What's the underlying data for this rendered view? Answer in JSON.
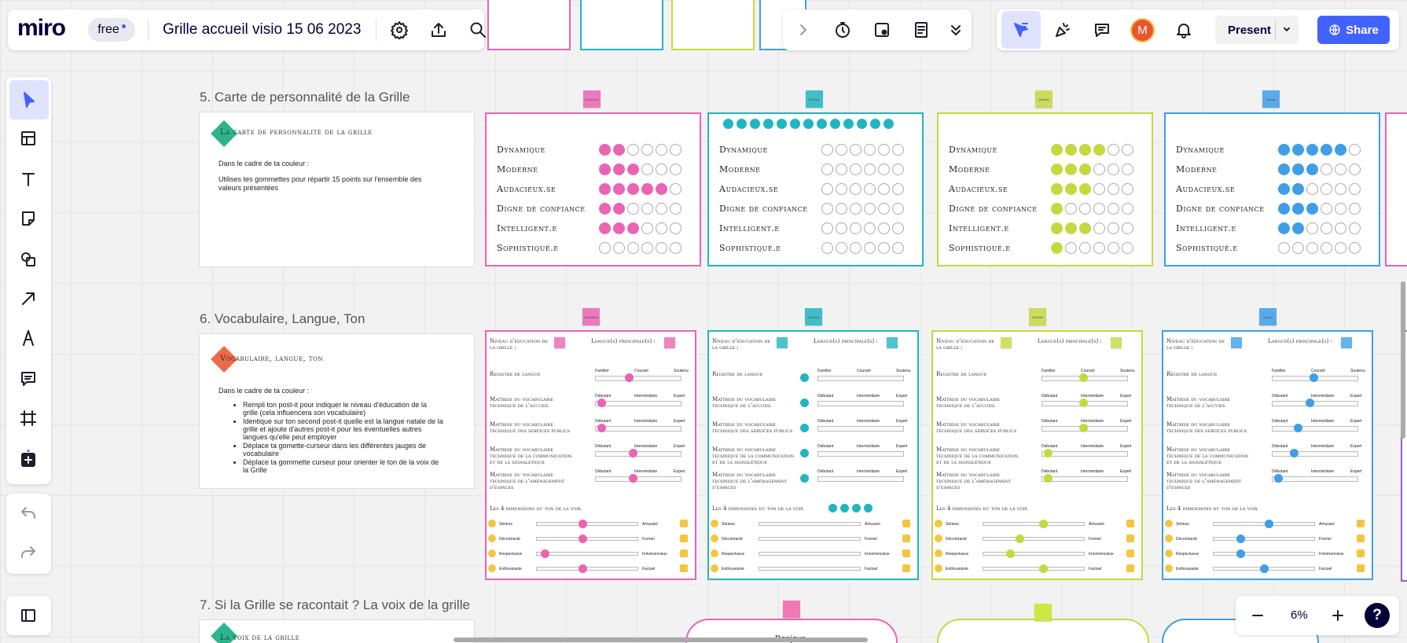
{
  "board": {
    "title": "Grille accueil visio 15 06 2023",
    "plan": "free",
    "zoom": "6%",
    "brand": "miro"
  },
  "toolbar": {
    "present_label": "Present",
    "share_label": "Share",
    "avatar_letter": "M"
  },
  "colors": {
    "pink": "#ea64b4",
    "teal": "#22b5c0",
    "lime": "#c4d93f",
    "blue": "#3f9ee8",
    "share": "#4262ff"
  },
  "sections": [
    {
      "title": "5. Carte de personnalité de la Grille"
    },
    {
      "title": "6. Vocabulaire, Langue, Ton"
    },
    {
      "title": "7. Si la Grille se racontait  ? La voix de la grille"
    }
  ],
  "card5": {
    "title": "La carte de personnalité de la grille",
    "line1": "Dans le cadre de ta couleur :",
    "line2": "Utilises tes gommettes pour répartir 15 points sur l'ensemble des valeurs présentées"
  },
  "card6": {
    "title": "Vocabulaire, langue, ton",
    "line1": "Dans le cadre de ta couleur :",
    "bullets": [
      "Rempli ton post-it pour indiquer le niveau d'éducation de la grille (cela influencera son vocabulaire)",
      "Identique sur ton second post-it quelle est la langue natale de la grille et ajoute d'autres post-it pour les éventuelles autres langues qu'elle peut employer",
      "Déplace ta gomette-curseur dans les différentes jauges de vocabulaire",
      "Déplace ta gommette curseur pour orienter le ton de la voix de la Grille"
    ]
  },
  "card7": {
    "title": "La voix de la grille"
  },
  "traits": [
    "Dynamique",
    "Moderne",
    "Audacieux.se",
    "Digne de confiance",
    "Intelligent.e",
    "Sophistiqué.e"
  ],
  "frames5": [
    {
      "color": "#ea64b4",
      "sticky": "Amandine",
      "filled": [
        2,
        3,
        5,
        2,
        3,
        0
      ]
    },
    {
      "color": "#22b5c0",
      "sticky": "Mélanie",
      "filled": [
        0,
        0,
        0,
        0,
        0,
        0
      ],
      "pool": 13
    },
    {
      "color": "#c4d93f",
      "sticky": "Noémie",
      "filled": [
        4,
        3,
        3,
        1,
        3,
        1
      ]
    },
    {
      "color": "#3f9ee8",
      "sticky": "Sabine",
      "filled": [
        5,
        3,
        2,
        3,
        2,
        0
      ]
    }
  ],
  "vocab": {
    "edu_label": "Niveau d'éducation de la grille :",
    "lang_label": "Langue(s) principale(s) :",
    "rows": [
      {
        "label": "Registre de langue",
        "ends": [
          "Familier",
          "Courant",
          "Soutenu"
        ]
      },
      {
        "label": "Maîtrise du vocabulaire technique de l'accueil",
        "ends": [
          "Débutant",
          "Intermédiaire",
          "Expert"
        ]
      },
      {
        "label": "Maîtrise du vocabulaire technique des services publics",
        "ends": [
          "Débutant",
          "Intermédiaire",
          "Expert"
        ]
      },
      {
        "label": "Maîtrise du vocabulaire technique de la communication et de la signalétique",
        "ends": [
          "Débutant",
          "Intermédiaire",
          "Expert"
        ]
      },
      {
        "label": "Maîtrise du vocabulaire technique de l'aménagement d'espaces",
        "ends": [
          "Débutant",
          "Intermédiaire",
          "Expert"
        ]
      }
    ],
    "tone_title": "Les 4 dimensions du ton de la voix",
    "tones": [
      [
        "Sérieux",
        "Amusant"
      ],
      [
        "Décontracté",
        "Formel"
      ],
      [
        "Respectueux",
        "Irrévérencieux"
      ],
      [
        "Enthousiaste",
        "Factuel"
      ]
    ],
    "frames": [
      {
        "color": "#ea64b4",
        "sticky": "Amandine",
        "knobs": [
          0.4,
          0.05,
          0.05,
          0.45,
          0.45
        ],
        "tone_knobs": [
          0.45,
          0.45,
          0.05,
          0.45
        ]
      },
      {
        "color": "#22b5c0",
        "sticky": "Mélanie",
        "knobs": [
          -1,
          -1,
          -1,
          -1,
          -1
        ],
        "tone_knobs": [
          -1,
          -1,
          -1,
          -1
        ]
      },
      {
        "color": "#c4d93f",
        "sticky": "Noémie",
        "knobs": [
          0.5,
          0.5,
          0.5,
          0.05,
          0.05
        ],
        "tone_knobs": [
          0.6,
          0.35,
          0.25,
          0.6
        ]
      },
      {
        "color": "#3f9ee8",
        "sticky": "Sabine",
        "knobs": [
          0.5,
          0.45,
          0.3,
          0.25,
          0.05
        ],
        "tone_knobs": [
          0.55,
          0.25,
          0.25,
          0.5
        ]
      }
    ]
  },
  "bottom_bubble_text": "Bonjour"
}
